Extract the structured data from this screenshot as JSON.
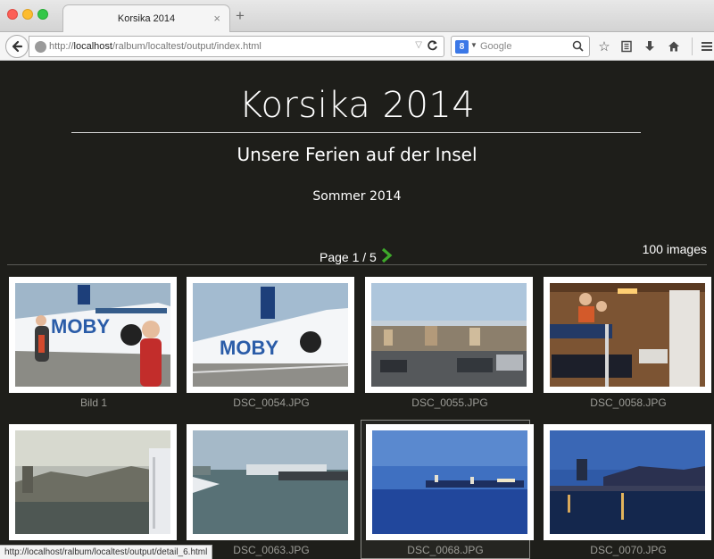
{
  "browser": {
    "tab_title": "Korsika 2014",
    "tab_close": "×",
    "new_tab": "+",
    "url_prefix": "http://",
    "url_host": "localhost",
    "url_path": "/ralbum/localtest/output/index.html",
    "search_placeholder": "Google",
    "status_url": "http://localhost/ralbum/localtest/output/detail_6.html"
  },
  "album": {
    "title": "Korsika 2014",
    "subtitle": "Unsere Ferien auf der Insel",
    "date": "Sommer 2014",
    "pager": "Page 1 / 5",
    "count": "100 images"
  },
  "thumbnails": [
    {
      "caption": "Bild 1"
    },
    {
      "caption": "DSC_0054.JPG"
    },
    {
      "caption": "DSC_0055.JPG"
    },
    {
      "caption": "DSC_0058.JPG"
    },
    {
      "caption": ""
    },
    {
      "caption": "DSC_0063.JPG"
    },
    {
      "caption": "DSC_0068.JPG"
    },
    {
      "caption": "DSC_0070.JPG"
    }
  ],
  "colors": {
    "page_bg": "#1e1e1a",
    "accent_arrow": "#3ea82b",
    "caption": "#9c9c97"
  }
}
